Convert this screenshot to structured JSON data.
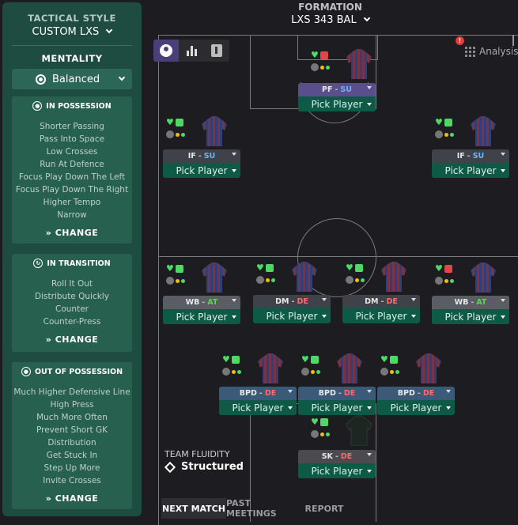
{
  "sidebar": {
    "tactical_style_label": "TACTICAL STYLE",
    "tactical_style_value": "CUSTOM LXS",
    "mentality_label": "MENTALITY",
    "mentality_value": "Balanced",
    "in_possession": {
      "title": "IN POSSESSION",
      "items": [
        "Shorter Passing",
        "Pass Into Space",
        "Low Crosses",
        "Run At Defence",
        "Focus Play Down The Left",
        "Focus Play Down The Right",
        "Higher Tempo",
        "Narrow"
      ],
      "change_label": "CHANGE"
    },
    "in_transition": {
      "title": "IN TRANSITION",
      "items": [
        "Roll It Out",
        "Distribute Quickly",
        "Counter",
        "Counter-Press"
      ],
      "change_label": "CHANGE"
    },
    "out_of_possession": {
      "title": "OUT OF POSSESSION",
      "items": [
        "Much Higher Defensive Line",
        "High Press",
        "Much More Often",
        "Prevent Short GK",
        "Distribution",
        "Get Stuck In",
        "Step Up More",
        "Invite Crosses"
      ],
      "change_label": "CHANGE"
    }
  },
  "formation": {
    "label": "FORMATION",
    "value": "LXS 343 BAL"
  },
  "analysis_label": "Analysis",
  "team_fluidity": {
    "label": "TEAM FLUIDITY",
    "value": "Structured"
  },
  "pick_player_label": "Pick Player",
  "positions": [
    {
      "pos": "PF",
      "duty": "SU",
      "highlight": true
    },
    {
      "pos": "IF",
      "duty": "SU"
    },
    {
      "pos": "IF",
      "duty": "SU"
    },
    {
      "pos": "WB",
      "duty": "AT"
    },
    {
      "pos": "DM",
      "duty": "DE"
    },
    {
      "pos": "DM",
      "duty": "DE"
    },
    {
      "pos": "WB",
      "duty": "AT"
    },
    {
      "pos": "BPD",
      "duty": "DE"
    },
    {
      "pos": "BPD",
      "duty": "DE"
    },
    {
      "pos": "BPD",
      "duty": "DE"
    },
    {
      "pos": "SK",
      "duty": "DE"
    }
  ],
  "bottom_tabs": [
    "NEXT MATCH",
    "PAST MEETINGS",
    "REPORT"
  ],
  "colors": {
    "sidebar_bg": "#1f4c41",
    "pick_bg": "#0d5b47",
    "duty_su": "#6ab4ff",
    "duty_at": "#5dd44f",
    "duty_de": "#ff6b6b",
    "highlight_role": "#5b4e8c"
  }
}
